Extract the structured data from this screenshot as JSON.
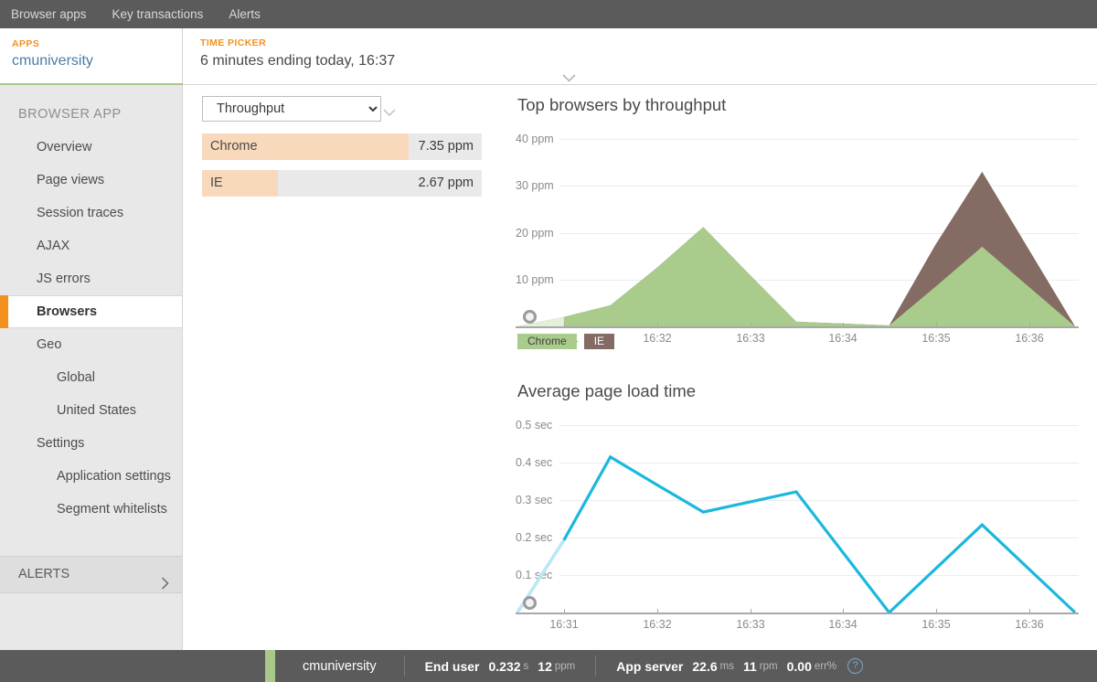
{
  "topnav": {
    "items": [
      {
        "label": "Browser apps"
      },
      {
        "label": "Key transactions"
      },
      {
        "label": "Alerts"
      }
    ]
  },
  "header": {
    "apps_kicker": "APPS",
    "app_name": "cmuniversity",
    "time_kicker": "TIME PICKER",
    "time_value": "6 minutes ending today, 16:37"
  },
  "sidebar": {
    "title": "BROWSER APP",
    "items": [
      {
        "label": "Overview",
        "level": 1,
        "active": false
      },
      {
        "label": "Page views",
        "level": 1,
        "active": false
      },
      {
        "label": "Session traces",
        "level": 1,
        "active": false
      },
      {
        "label": "AJAX",
        "level": 1,
        "active": false
      },
      {
        "label": "JS errors",
        "level": 1,
        "active": false
      },
      {
        "label": "Browsers",
        "level": 1,
        "active": true
      },
      {
        "label": "Geo",
        "level": 1,
        "active": false
      },
      {
        "label": "Global",
        "level": 2,
        "active": false
      },
      {
        "label": "United States",
        "level": 2,
        "active": false
      },
      {
        "label": "Settings",
        "level": 1,
        "active": false
      },
      {
        "label": "Application settings",
        "level": 2,
        "active": false
      },
      {
        "label": "Segment whitelists",
        "level": 2,
        "active": false
      }
    ],
    "alerts_label": "ALERTS"
  },
  "controls": {
    "metric_select_value": "Throughput",
    "metric_select_options": [
      "Throughput"
    ]
  },
  "browser_list": {
    "rows": [
      {
        "name": "Chrome",
        "value": "7.35 ppm",
        "fill_pct": 74
      },
      {
        "name": "IE",
        "value": "2.67 ppm",
        "fill_pct": 27
      }
    ]
  },
  "colors": {
    "chrome": "#a9cb8b",
    "ie": "#846b63",
    "page_load_line": "#1bb8de",
    "accent_orange": "#f3901d",
    "app_link": "#4a7ca8",
    "bar_fill": "#f9d9bb"
  },
  "chart_data": [
    {
      "type": "area",
      "id": "top-browsers-by-throughput",
      "title": "Top browsers by throughput",
      "stacked": true,
      "xlabel": "",
      "ylabel": "ppm",
      "ylim": [
        0,
        40
      ],
      "yticks": [
        40,
        30,
        20,
        10
      ],
      "ytick_labels": [
        "40 ppm",
        "30 ppm",
        "20 ppm",
        "10 ppm"
      ],
      "grid": true,
      "x": [
        "16:30:30",
        "16:31",
        "16:31:30",
        "16:32",
        "16:32:30",
        "16:33",
        "16:33:30",
        "16:34",
        "16:34:30",
        "16:35",
        "16:35:30",
        "16:36",
        "16:36:30"
      ],
      "xtick_labels": [
        "16:31",
        "16:32",
        "16:33",
        "16:34",
        "16:35",
        "16:36"
      ],
      "legend": [
        "Chrome",
        "IE"
      ],
      "legend_position": "bottom-left",
      "series": [
        {
          "name": "Chrome",
          "color": "#a9cb8b",
          "values": [
            0,
            2.0,
            4.5,
            12.5,
            21.2,
            11.0,
            1.0,
            0.6,
            0.2,
            8.5,
            17.0,
            8.5,
            0
          ]
        },
        {
          "name": "IE",
          "color": "#846b63",
          "values": [
            0,
            0,
            0,
            0,
            0,
            0,
            0,
            0,
            0,
            9.0,
            16.0,
            8.0,
            0
          ]
        }
      ]
    },
    {
      "type": "line",
      "id": "average-page-load-time",
      "title": "Average page load time",
      "xlabel": "",
      "ylabel": "sec",
      "ylim": [
        0,
        0.5
      ],
      "yticks": [
        0.5,
        0.4,
        0.3,
        0.2,
        0.1
      ],
      "ytick_labels": [
        "0.5 sec",
        "0.4 sec",
        "0.3 sec",
        "0.2 sec",
        "0.1 sec"
      ],
      "grid": true,
      "x": [
        "16:30:30",
        "16:31",
        "16:31:30",
        "16:32",
        "16:32:30",
        "16:33",
        "16:33:30",
        "16:34",
        "16:34:30",
        "16:35",
        "16:35:30",
        "16:36",
        "16:36:30"
      ],
      "xtick_labels": [
        "16:31",
        "16:32",
        "16:33",
        "16:34",
        "16:35",
        "16:36"
      ],
      "series": [
        {
          "name": "Average page load time",
          "color": "#1bb8de",
          "values": [
            0,
            0.193,
            0.415,
            0.341,
            0.268,
            0.295,
            0.322,
            0.161,
            0.0,
            0.117,
            0.234,
            0.117,
            0.0
          ]
        }
      ]
    }
  ],
  "statusbar": {
    "app_name": "cmuniversity",
    "groups": [
      {
        "label": "End user",
        "metrics": [
          {
            "value": "0.232",
            "unit": "s"
          },
          {
            "value": "12",
            "unit": "ppm"
          }
        ]
      },
      {
        "label": "App server",
        "metrics": [
          {
            "value": "22.6",
            "unit": "ms"
          },
          {
            "value": "11",
            "unit": "rpm"
          },
          {
            "value": "0.00",
            "unit": "err%"
          }
        ]
      }
    ],
    "help_glyph": "?"
  }
}
